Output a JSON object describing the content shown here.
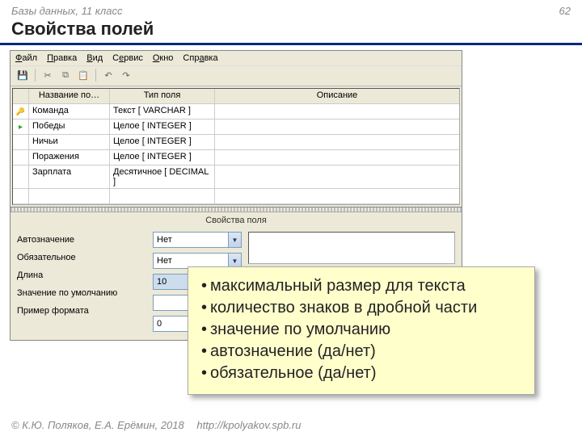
{
  "header": {
    "course": "Базы данных, 11 класс",
    "page": "62"
  },
  "title": "Свойства полей",
  "menu": {
    "file": "Файл",
    "edit": "Правка",
    "view": "Вид",
    "service": "Сервис",
    "window": "Окно",
    "help": "Справка"
  },
  "gridHead": {
    "name": "Название по…",
    "type": "Тип поля",
    "desc": "Описание"
  },
  "rows": [
    {
      "icon": "key",
      "name": "Команда",
      "type": "Текст [ VARCHAR ]"
    },
    {
      "icon": "arrow",
      "name": "Победы",
      "type": "Целое [ INTEGER ]"
    },
    {
      "icon": "",
      "name": "Ничьи",
      "type": "Целое [ INTEGER ]"
    },
    {
      "icon": "",
      "name": "Поражения",
      "type": "Целое [ INTEGER ]"
    },
    {
      "icon": "",
      "name": "Зарплата",
      "type": "Десятичное [ DECIMAL ]"
    }
  ],
  "propTitle": "Свойства поля",
  "props": {
    "auto": {
      "label": "Автозначение",
      "value": "Нет",
      "kind": "combo"
    },
    "required": {
      "label": "Обязательное",
      "value": "Нет",
      "kind": "combo"
    },
    "length": {
      "label": "Длина",
      "value": "10",
      "kind": "text"
    },
    "default": {
      "label": "Значение по умолчанию",
      "value": "",
      "kind": "text"
    },
    "format": {
      "label": "Пример формата",
      "value": "0",
      "kind": "num"
    }
  },
  "callout": [
    "максимальный размер для текста",
    "количество знаков в дробной части",
    "значение по умолчанию",
    "автозначение (да/нет)",
    "обязательное (да/нет)"
  ],
  "footer": {
    "copyright": "© К.Ю. Поляков, Е.А. Ерёмин, 2018",
    "url": "http://kpolyakov.spb.ru"
  }
}
